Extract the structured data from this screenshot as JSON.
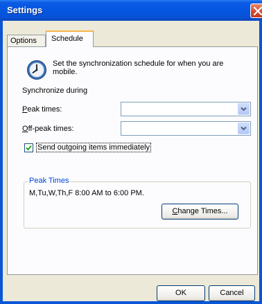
{
  "window": {
    "title": "Settings"
  },
  "tabs": [
    {
      "label": "Options",
      "selected": false
    },
    {
      "label": "Schedule",
      "selected": true
    }
  ],
  "schedule": {
    "intro_text": "Set the synchronization schedule for when you are mobile.",
    "sync_during_label": "Synchronize during",
    "peak_times": {
      "label_mnemonic": "P",
      "label_rest": "eak times:",
      "value": ""
    },
    "off_peak_times": {
      "label_mnemonic": "O",
      "label_rest": "ff-peak times:",
      "value": ""
    },
    "send_immediately": {
      "label": "Send outgoing items immediately",
      "checked": true
    }
  },
  "peak_times_group": {
    "title": "Peak Times",
    "schedule_text": "M,Tu,W,Th,F 8:00 AM to 6:00 PM.",
    "change_button": {
      "label_mnemonic": "C",
      "label_rest": "hange Times..."
    }
  },
  "footer": {
    "ok_label": "OK",
    "cancel_label": "Cancel"
  },
  "icons": [
    "clock-icon",
    "close-icon",
    "dropdown-arrow-icon",
    "checkmark-icon"
  ],
  "colors": {
    "titlebar": "#0556e0",
    "group_title": "#0046d5",
    "close": "#d5452a",
    "tab_highlight": "#f7b64a"
  }
}
